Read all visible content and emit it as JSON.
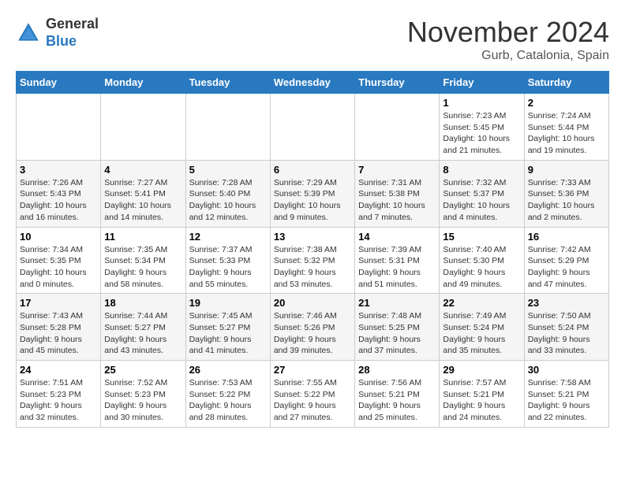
{
  "header": {
    "logo_line1": "General",
    "logo_line2": "Blue",
    "month": "November 2024",
    "location": "Gurb, Catalonia, Spain"
  },
  "weekdays": [
    "Sunday",
    "Monday",
    "Tuesday",
    "Wednesday",
    "Thursday",
    "Friday",
    "Saturday"
  ],
  "weeks": [
    [
      {
        "day": "",
        "info": ""
      },
      {
        "day": "",
        "info": ""
      },
      {
        "day": "",
        "info": ""
      },
      {
        "day": "",
        "info": ""
      },
      {
        "day": "",
        "info": ""
      },
      {
        "day": "1",
        "info": "Sunrise: 7:23 AM\nSunset: 5:45 PM\nDaylight: 10 hours and 21 minutes."
      },
      {
        "day": "2",
        "info": "Sunrise: 7:24 AM\nSunset: 5:44 PM\nDaylight: 10 hours and 19 minutes."
      }
    ],
    [
      {
        "day": "3",
        "info": "Sunrise: 7:26 AM\nSunset: 5:43 PM\nDaylight: 10 hours and 16 minutes."
      },
      {
        "day": "4",
        "info": "Sunrise: 7:27 AM\nSunset: 5:41 PM\nDaylight: 10 hours and 14 minutes."
      },
      {
        "day": "5",
        "info": "Sunrise: 7:28 AM\nSunset: 5:40 PM\nDaylight: 10 hours and 12 minutes."
      },
      {
        "day": "6",
        "info": "Sunrise: 7:29 AM\nSunset: 5:39 PM\nDaylight: 10 hours and 9 minutes."
      },
      {
        "day": "7",
        "info": "Sunrise: 7:31 AM\nSunset: 5:38 PM\nDaylight: 10 hours and 7 minutes."
      },
      {
        "day": "8",
        "info": "Sunrise: 7:32 AM\nSunset: 5:37 PM\nDaylight: 10 hours and 4 minutes."
      },
      {
        "day": "9",
        "info": "Sunrise: 7:33 AM\nSunset: 5:36 PM\nDaylight: 10 hours and 2 minutes."
      }
    ],
    [
      {
        "day": "10",
        "info": "Sunrise: 7:34 AM\nSunset: 5:35 PM\nDaylight: 10 hours and 0 minutes."
      },
      {
        "day": "11",
        "info": "Sunrise: 7:35 AM\nSunset: 5:34 PM\nDaylight: 9 hours and 58 minutes."
      },
      {
        "day": "12",
        "info": "Sunrise: 7:37 AM\nSunset: 5:33 PM\nDaylight: 9 hours and 55 minutes."
      },
      {
        "day": "13",
        "info": "Sunrise: 7:38 AM\nSunset: 5:32 PM\nDaylight: 9 hours and 53 minutes."
      },
      {
        "day": "14",
        "info": "Sunrise: 7:39 AM\nSunset: 5:31 PM\nDaylight: 9 hours and 51 minutes."
      },
      {
        "day": "15",
        "info": "Sunrise: 7:40 AM\nSunset: 5:30 PM\nDaylight: 9 hours and 49 minutes."
      },
      {
        "day": "16",
        "info": "Sunrise: 7:42 AM\nSunset: 5:29 PM\nDaylight: 9 hours and 47 minutes."
      }
    ],
    [
      {
        "day": "17",
        "info": "Sunrise: 7:43 AM\nSunset: 5:28 PM\nDaylight: 9 hours and 45 minutes."
      },
      {
        "day": "18",
        "info": "Sunrise: 7:44 AM\nSunset: 5:27 PM\nDaylight: 9 hours and 43 minutes."
      },
      {
        "day": "19",
        "info": "Sunrise: 7:45 AM\nSunset: 5:27 PM\nDaylight: 9 hours and 41 minutes."
      },
      {
        "day": "20",
        "info": "Sunrise: 7:46 AM\nSunset: 5:26 PM\nDaylight: 9 hours and 39 minutes."
      },
      {
        "day": "21",
        "info": "Sunrise: 7:48 AM\nSunset: 5:25 PM\nDaylight: 9 hours and 37 minutes."
      },
      {
        "day": "22",
        "info": "Sunrise: 7:49 AM\nSunset: 5:24 PM\nDaylight: 9 hours and 35 minutes."
      },
      {
        "day": "23",
        "info": "Sunrise: 7:50 AM\nSunset: 5:24 PM\nDaylight: 9 hours and 33 minutes."
      }
    ],
    [
      {
        "day": "24",
        "info": "Sunrise: 7:51 AM\nSunset: 5:23 PM\nDaylight: 9 hours and 32 minutes."
      },
      {
        "day": "25",
        "info": "Sunrise: 7:52 AM\nSunset: 5:23 PM\nDaylight: 9 hours and 30 minutes."
      },
      {
        "day": "26",
        "info": "Sunrise: 7:53 AM\nSunset: 5:22 PM\nDaylight: 9 hours and 28 minutes."
      },
      {
        "day": "27",
        "info": "Sunrise: 7:55 AM\nSunset: 5:22 PM\nDaylight: 9 hours and 27 minutes."
      },
      {
        "day": "28",
        "info": "Sunrise: 7:56 AM\nSunset: 5:21 PM\nDaylight: 9 hours and 25 minutes."
      },
      {
        "day": "29",
        "info": "Sunrise: 7:57 AM\nSunset: 5:21 PM\nDaylight: 9 hours and 24 minutes."
      },
      {
        "day": "30",
        "info": "Sunrise: 7:58 AM\nSunset: 5:21 PM\nDaylight: 9 hours and 22 minutes."
      }
    ]
  ]
}
